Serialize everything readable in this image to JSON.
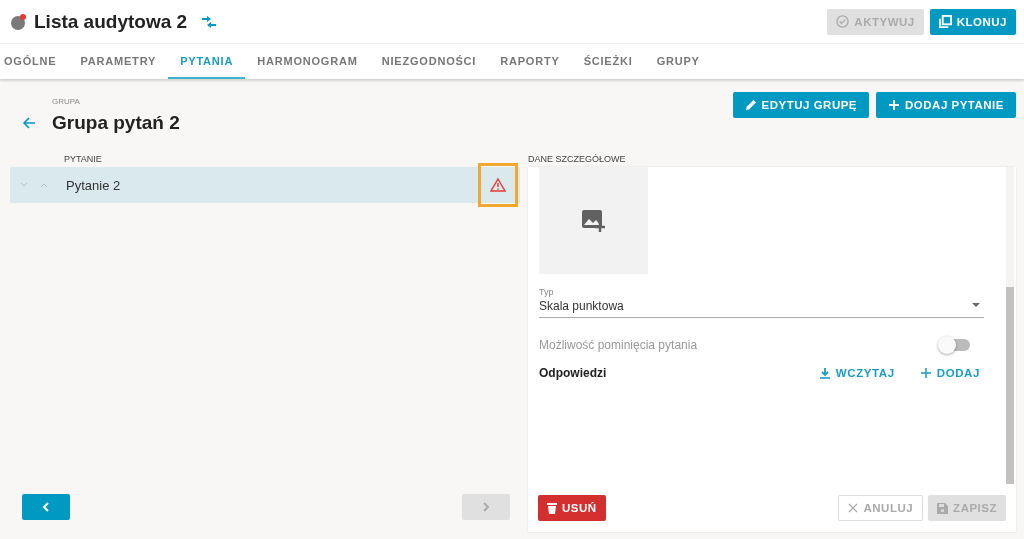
{
  "header": {
    "title": "Lista audytowa 2",
    "buttons": [
      {
        "label": "AKTYWUJ",
        "kind": "check",
        "disabled": true
      },
      {
        "label": "KLONUJ",
        "kind": "copy",
        "disabled": false
      }
    ]
  },
  "tabs": [
    {
      "label": "OGÓLNE",
      "selected": false
    },
    {
      "label": "PARAMETRY",
      "selected": false
    },
    {
      "label": "PYTANIA",
      "selected": true
    },
    {
      "label": "HARMONOGRAM",
      "selected": false
    },
    {
      "label": "NIEZGODNOŚCI",
      "selected": false
    },
    {
      "label": "RAPORTY",
      "selected": false
    },
    {
      "label": "ŚCIEŻKI",
      "selected": false
    },
    {
      "label": "GRUPY",
      "selected": false
    }
  ],
  "group": {
    "caption": "GRUPA",
    "title": "Grupa pytań 2",
    "buttons": [
      {
        "label": "EDYTUJ GRUPĘ",
        "kind": "edit"
      },
      {
        "label": "DODAJ PYTANIE",
        "kind": "add"
      }
    ]
  },
  "questions": {
    "heading": "PYTANIE",
    "items": [
      {
        "text": "Pytanie 2",
        "selected": true,
        "warning": true,
        "highlighted": true
      }
    ]
  },
  "details": {
    "heading": "DANE SZCZEGÓŁOWE",
    "type_label": "Typ",
    "type_value": "Skala punktowa",
    "toggle": {
      "label": "Możliwość pominięcia pytania",
      "on": false
    },
    "answers": {
      "heading": "Odpowiedzi",
      "actions": [
        {
          "label": "WCZYTAJ",
          "kind": "download"
        },
        {
          "label": "DODAJ",
          "kind": "add"
        }
      ]
    }
  },
  "footer": {
    "prev_disabled": false,
    "next_disabled": true,
    "delete": "USUŃ",
    "cancel": {
      "label": "ANULUJ",
      "disabled": false
    },
    "save": {
      "label": "ZAPISZ",
      "disabled": true
    }
  }
}
